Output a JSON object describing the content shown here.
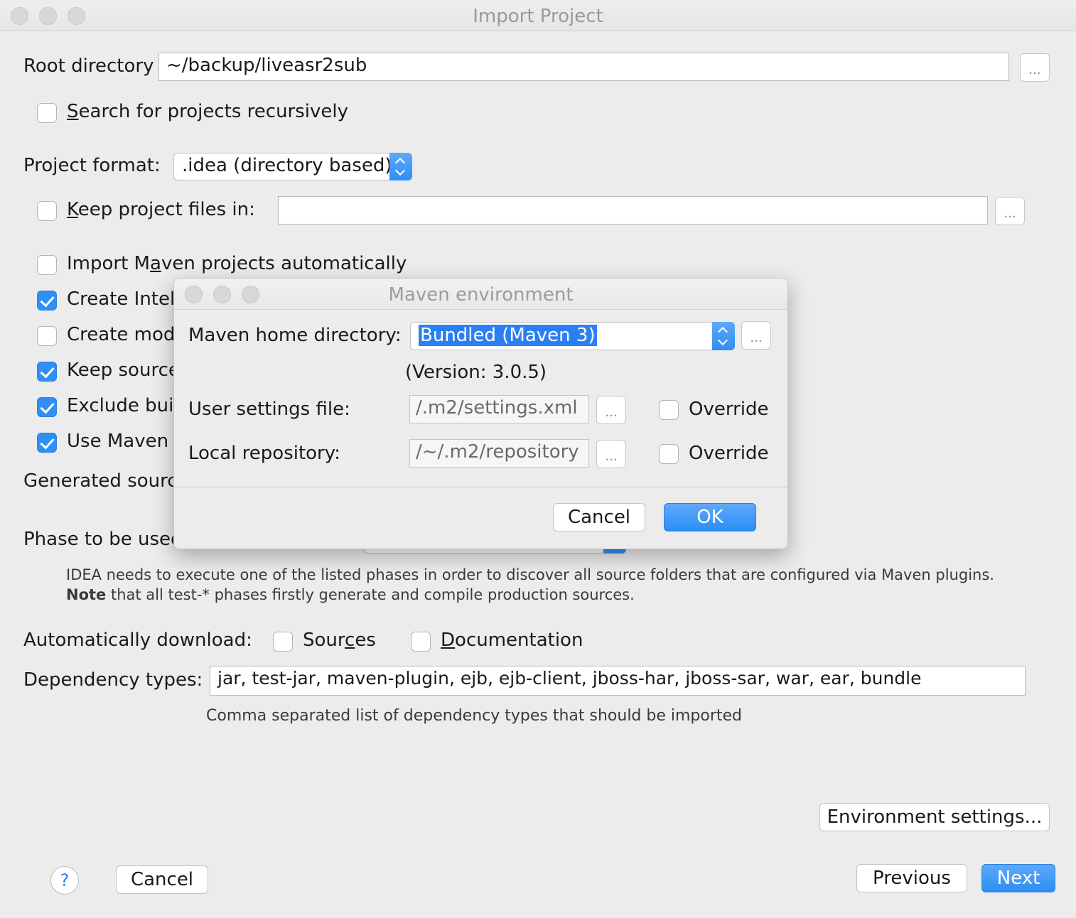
{
  "window": {
    "title": "Import Project"
  },
  "form": {
    "root_directory_label": "Root directory",
    "root_directory_value": "~/backup/liveasr2sub",
    "browse_label": "...",
    "search_recursive_label_u": "S",
    "search_recursive_label_rest": "earch for projects recursively",
    "project_format_label": "Project format:",
    "project_format_value": ".idea (directory based)",
    "keep_files_label_u": "K",
    "keep_files_label_rest": "eep project files in:",
    "keep_files_value": "",
    "import_maven_label_a": "Import M",
    "import_maven_label_u": "a",
    "import_maven_label_b": "ven projects automatically",
    "create_intellij_label": "Create Intell",
    "create_module_label": "Create modu",
    "keep_source_label": "Keep source",
    "exclude_build_label": "Exclude buil",
    "use_maven_label": "Use Maven g",
    "generated_sources_label": "Generated source",
    "phase_label": "Phase to be used",
    "phase_note_line1": "IDEA needs to execute one of the listed phases in order to discover all source folders that are configured via Maven plugins.",
    "phase_note_bold": "Note",
    "phase_note_line2": " that all test-* phases firstly generate and compile production sources.",
    "auto_download_label": "Automatically download:",
    "sources_label_a": "Sour",
    "sources_label_u": "c",
    "sources_label_b": "es",
    "documentation_label_u": "D",
    "documentation_label_rest": "ocumentation",
    "dependency_types_label": "Dependency types:",
    "dependency_types_value": "jar, test-jar, maven-plugin, ejb, ejb-client, jboss-har, jboss-sar, war, ear, bundle",
    "dependency_types_hint": "Comma separated list of dependency types that should be imported"
  },
  "buttons": {
    "environment_settings": "Environment settings...",
    "help": "?",
    "cancel": "Cancel",
    "previous": "Previous",
    "next": "Next"
  },
  "modal": {
    "title": "Maven environment",
    "maven_home_label": "Maven home directory:",
    "maven_home_value": "Bundled (Maven 3)",
    "version_text": "(Version: 3.0.5)",
    "user_settings_label": "User settings file:",
    "user_settings_value": "/.m2/settings.xml",
    "local_repo_label": "Local repository:",
    "local_repo_value": "/~/.m2/repository",
    "override_label": "Override",
    "browse_label": "...",
    "cancel": "Cancel",
    "ok": "OK"
  },
  "state": {
    "search_recursive": false,
    "keep_files": false,
    "import_maven_auto": false,
    "create_intellij": true,
    "create_module": false,
    "keep_source": true,
    "exclude_build": true,
    "use_maven": true,
    "download_sources": false,
    "download_docs": false,
    "user_settings_override": false,
    "local_repo_override": false
  },
  "colors": {
    "accent": "#2e8ff6",
    "background": "#ececec",
    "selection": "#2a7ff2"
  }
}
